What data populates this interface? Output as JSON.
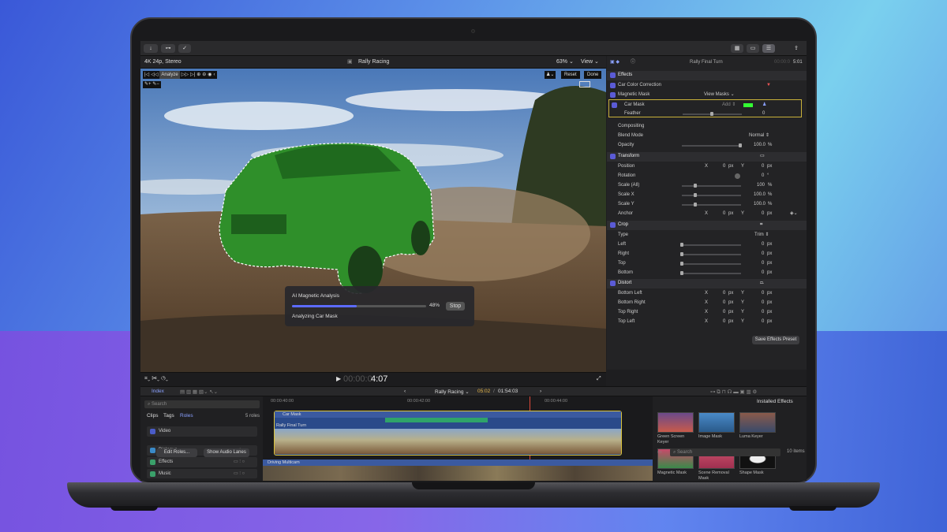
{
  "toolbar": {
    "icons": [
      "import-icon",
      "keyword-icon",
      "check-icon"
    ]
  },
  "viewer_header": {
    "format": "4K 24p, Stereo",
    "project": "Rally Racing",
    "zoom": "63%",
    "view": "View"
  },
  "viewer_tools": {
    "analyze": "Analyze",
    "reset": "Reset",
    "done": "Done"
  },
  "analysis": {
    "title": "AI Magnetic Analysis",
    "percent": "48%",
    "progress": 0.48,
    "stop": "Stop",
    "status": "Analyzing Car Mask"
  },
  "controls": {
    "timecode_dim": "00:00:0",
    "timecode": "4:07"
  },
  "inspector": {
    "title": "Rally Final Turn",
    "time_dim": "00:00:0",
    "time": "5:01",
    "effects": "Effects",
    "car_color": "Car Color Correction",
    "magnetic_mask": "Magnetic Mask",
    "view_masks": "View Masks",
    "car_mask": "Car Mask",
    "add": "Add",
    "feather": "Feather",
    "feather_val": "0",
    "compositing": "Compositing",
    "blend_mode": "Blend Mode",
    "blend_val": "Normal",
    "opacity": "Opacity",
    "opacity_val": "100.0",
    "pct": "%",
    "transform": "Transform",
    "position": "Position",
    "rotation": "Rotation",
    "rotation_val": "0",
    "deg": "°",
    "scale_all": "Scale (All)",
    "scale_all_val": "100",
    "scale_x": "Scale X",
    "scale_x_val": "100.0",
    "scale_y": "Scale Y",
    "scale_y_val": "100.0",
    "anchor": "Anchor",
    "x": "X",
    "y": "Y",
    "zero": "0",
    "px": "px",
    "crop": "Crop",
    "type": "Type",
    "trim": "Trim",
    "left": "Left",
    "right": "Right",
    "top": "Top",
    "bottom": "Bottom",
    "distort": "Distort",
    "bottom_left": "Bottom Left",
    "bottom_right": "Bottom Right",
    "top_right": "Top Right",
    "top_left": "Top Left",
    "save_preset": "Save Effects Preset"
  },
  "timeline": {
    "index": "Index",
    "project": "Rally Racing",
    "position": "05:02",
    "duration": "01:54:03",
    "ruler": [
      "00:00:40:00",
      "00:00:42:00",
      "00:00:44:00"
    ],
    "car_mask": "Car Mask",
    "clip": "Rally Final Turn",
    "multicam": "Driving Multicam"
  },
  "library": {
    "search": "Search",
    "tabs": [
      "Clips",
      "Tags",
      "Roles"
    ],
    "roles_count": "5 roles",
    "roles": [
      "Video",
      "Dialogue",
      "Effects",
      "Music"
    ],
    "edit_roles": "Edit Roles...",
    "show_lanes": "Show Audio Lanes"
  },
  "effects_browser": {
    "title": "Installed Effects",
    "items": [
      "Green Screen Keyer",
      "Image Mask",
      "Luma Keyer",
      "Magnetic Mask",
      "Scene Removal Mask",
      "Shape Mask"
    ],
    "search": "Search",
    "count": "10 items"
  }
}
